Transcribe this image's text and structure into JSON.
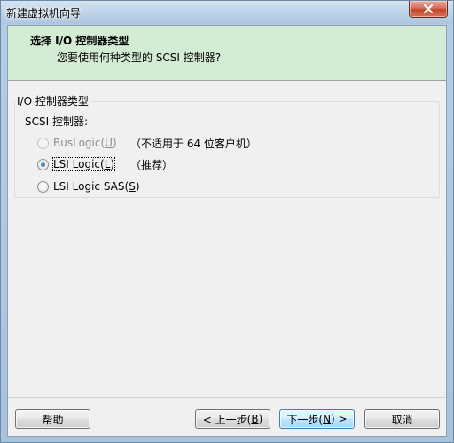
{
  "window": {
    "title": "新建虚拟机向导",
    "close_icon": "close-icon"
  },
  "header": {
    "title": "选择 I/O 控制器类型",
    "subtitle": "您要使用何种类型的 SCSI 控制器?"
  },
  "group": {
    "legend": "I/O 控制器类型",
    "scsi_label": "SCSI 控制器:",
    "options": [
      {
        "label_pre": "BusLogic(",
        "accel": "U",
        "label_post": ")",
        "note": "（不适用于 64 位客户机）",
        "checked": false,
        "disabled": true
      },
      {
        "label_pre": "LSI Logic(",
        "accel": "L",
        "label_post": ")",
        "note": "（推荐）",
        "checked": true,
        "disabled": false
      },
      {
        "label_pre": "LSI Logic SAS(",
        "accel": "S",
        "label_post": ")",
        "note": "",
        "checked": false,
        "disabled": false
      }
    ]
  },
  "buttons": {
    "help": "帮助",
    "back_pre": "< 上一步(",
    "back_accel": "B",
    "back_post": ")",
    "next_pre": "下一步(",
    "next_accel": "N",
    "next_post": ") >",
    "cancel": "取消"
  },
  "colors": {
    "header_bg": "#d4ebd4",
    "title_bar": "#bcd1e7",
    "close_button": "#c0442a"
  }
}
